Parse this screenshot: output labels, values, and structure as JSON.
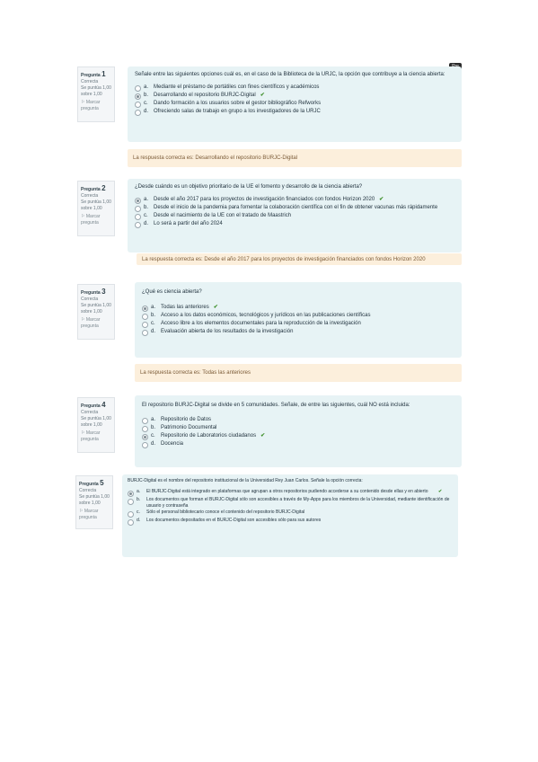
{
  "tag_label": "Pre",
  "questions": [
    {
      "header": "Pregunta",
      "number": "1",
      "status": "Correcta",
      "score": "Se puntúa 1,00 sobre 1,00",
      "flag": "Marcar pregunta",
      "text": "Señale entre las siguientes opciones cuál es, en el caso de la Biblioteca de la URJC, la opción que contribuye a la ciencia abierta:",
      "options": [
        {
          "letter": "a.",
          "text": "Mediante el préstamo de portátiles con fines científicos y académicos",
          "selected": false,
          "correct": false
        },
        {
          "letter": "b.",
          "text": "Desarrollando el repositorio BURJC-Digital",
          "selected": true,
          "correct": true
        },
        {
          "letter": "c.",
          "text": "Dando formación a los usuarios sobre el gestor bibliográfico Refworks",
          "selected": false,
          "correct": false
        },
        {
          "letter": "d.",
          "text": "Ofreciendo salas de trabajo en grupo a los investigadores de la URJC",
          "selected": false,
          "correct": false
        }
      ],
      "feedback": "La respuesta correcta es: Desarrollando el repositorio BURJC-Digital"
    },
    {
      "header": "Pregunta",
      "number": "2",
      "status": "Correcta",
      "score": "Se puntúa 1,00 sobre 1,00",
      "flag": "Marcar pregunta",
      "text": "¿Desde cuándo es un objetivo prioritario de la UE el fomento y desarrollo de la ciencia abierta?",
      "options": [
        {
          "letter": "a.",
          "text": "Desde el año 2017 para los proyectos de investigación financiados con fondos Horizon 2020",
          "selected": true,
          "correct": true
        },
        {
          "letter": "b.",
          "text": "Desde el inicio de la pandemia para fomentar la colaboración científica con el fin de obtener vacunas más rápidamente",
          "selected": false,
          "correct": false
        },
        {
          "letter": "c.",
          "text": "Desde el nacimiento de la UE con el tratado de Maastrich",
          "selected": false,
          "correct": false
        },
        {
          "letter": "d.",
          "text": "Lo será a partir del año 2024",
          "selected": false,
          "correct": false
        }
      ],
      "feedback": "La respuesta correcta es: Desde el año 2017 para los proyectos de investigación financiados con fondos Horizon 2020"
    },
    {
      "header": "Pregunta",
      "number": "3",
      "status": "Correcta",
      "score": "Se puntúa 1,00 sobre 1,00",
      "flag": "Marcar pregunta",
      "text": "¿Qué es ciencia abierta?",
      "options": [
        {
          "letter": "a.",
          "text": "Todas las anteriores",
          "selected": true,
          "correct": true
        },
        {
          "letter": "b.",
          "text": "Acceso a los datos económicos, tecnológicos y jurídicos en las publicaciones científicas",
          "selected": false,
          "correct": false
        },
        {
          "letter": "c.",
          "text": "Acceso libre a los elementos documentales para la reproducción de la investigación",
          "selected": false,
          "correct": false
        },
        {
          "letter": "d.",
          "text": "Evaluación abierta de los resultados de la investigación",
          "selected": false,
          "correct": false
        }
      ],
      "feedback": "La respuesta correcta es: Todas las anteriores"
    },
    {
      "header": "Pregunta",
      "number": "4",
      "status": "Correcta",
      "score": "Se puntúa 1,00 sobre 1,00",
      "flag": "Marcar pregunta",
      "text": "El repositorio BURJC-Digital se divide en 5 comunidades. Señale, de entre las siguientes, cuál NO está incluida:",
      "options": [
        {
          "letter": "a.",
          "text": "Repositorio de Datos",
          "selected": false,
          "correct": false
        },
        {
          "letter": "b.",
          "text": "Patrimonio Documental",
          "selected": false,
          "correct": false
        },
        {
          "letter": "c.",
          "text": "Repositorio de Laboratorios ciudadanos",
          "selected": true,
          "correct": true
        },
        {
          "letter": "d.",
          "text": "Docencia",
          "selected": false,
          "correct": false
        }
      ],
      "feedback": ""
    },
    {
      "header": "Pregunta",
      "number": "5",
      "status": "Correcta",
      "score": "Se puntúa 1,00 sobre 1,00",
      "flag": "Marcar pregunta",
      "text": "BURJC-Digital es el nombre del repositorio institucional de la Universidad Rey Juan Carlos. Señale la opción correcta:",
      "options": [
        {
          "letter": "a.",
          "text": "El BURJC-Digital está integrado en plataformas que agrupan a otros repositorios pudiendo accederse a su contenido desde ellas y en abierto",
          "selected": true,
          "correct": true
        },
        {
          "letter": "b.",
          "text": "Los documentos que forman el BURJC-Digital sólo son accesibles a través de My-Apps para los miembros de la Universidad, mediante identificación de usuario y contraseña",
          "selected": false,
          "correct": false
        },
        {
          "letter": "c.",
          "text": "Sólo el personal bibliotecario conoce el contenido del repositorio BURJC-Digital",
          "selected": false,
          "correct": false
        },
        {
          "letter": "d.",
          "text": "Los documentos depositados en el BURJC-Digital son accesibles sólo para sus autores",
          "selected": false,
          "correct": false
        }
      ],
      "feedback": ""
    }
  ]
}
